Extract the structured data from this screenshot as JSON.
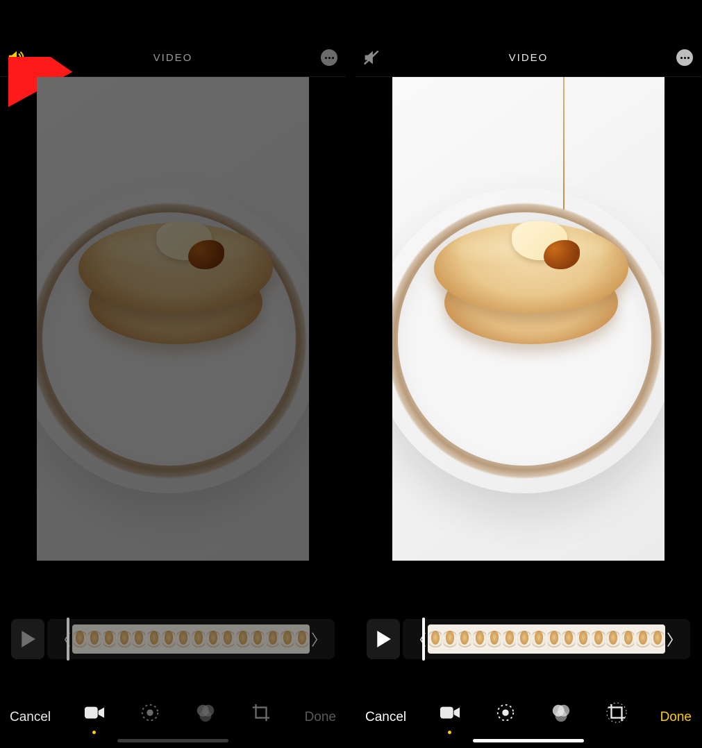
{
  "left": {
    "title": "VIDEO",
    "cancel": "Cancel",
    "done": "Done",
    "sound_on": true,
    "thumbs": 16,
    "tools": [
      "video",
      "adjust",
      "filters",
      "crop"
    ]
  },
  "right": {
    "title": "VIDEO",
    "cancel": "Cancel",
    "done": "Done",
    "sound_on": false,
    "thumbs": 16,
    "tools": [
      "video",
      "adjust",
      "filters",
      "crop"
    ]
  }
}
